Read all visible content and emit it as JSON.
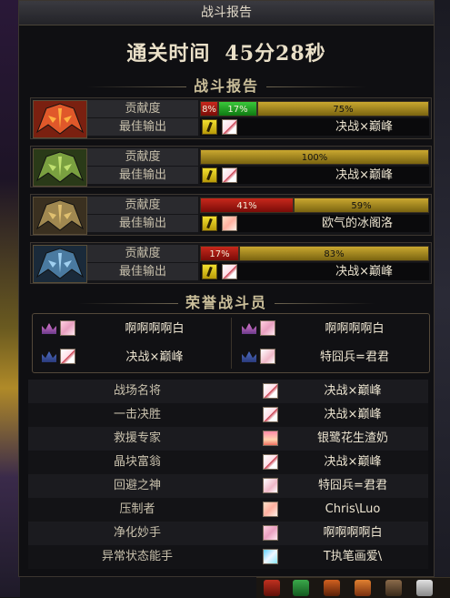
{
  "window": {
    "title": "战斗报告"
  },
  "clear_time": {
    "label": "通关时间",
    "value": "45分28秒"
  },
  "sections": {
    "battle_report": "战斗报告",
    "honor": "荣誉战斗员"
  },
  "teams": [
    {
      "contribution_label": "贡献度",
      "best_label": "最佳输出",
      "best_name": "决战×巅峰",
      "segments": [
        {
          "color": "red",
          "percent": 8,
          "text": "8%"
        },
        {
          "color": "green",
          "percent": 17,
          "text": "17%"
        },
        {
          "color": "gold",
          "percent": 75,
          "text": "75%"
        }
      ]
    },
    {
      "contribution_label": "贡献度",
      "best_label": "最佳输出",
      "best_name": "决战×巅峰",
      "segments": [
        {
          "color": "gold",
          "percent": 100,
          "text": "100%"
        }
      ]
    },
    {
      "contribution_label": "贡献度",
      "best_label": "最佳输出",
      "best_name": "欧气的冰阁洛",
      "segments": [
        {
          "color": "red",
          "percent": 41,
          "text": "41%"
        },
        {
          "color": "gold",
          "percent": 59,
          "text": "59%"
        }
      ]
    },
    {
      "contribution_label": "贡献度",
      "best_label": "最佳输出",
      "best_name": "决战×巅峰",
      "segments": [
        {
          "color": "red",
          "percent": 17,
          "text": "17%"
        },
        {
          "color": "gold",
          "percent": 83,
          "text": "83%"
        }
      ]
    }
  ],
  "honor_members": [
    {
      "name": "啊啊啊啊白"
    },
    {
      "name": "啊啊啊啊白"
    },
    {
      "name": "决战×巅峰"
    },
    {
      "name": "特囧兵=君君"
    }
  ],
  "awards": [
    {
      "title": "战场名将",
      "name": "决战×巅峰"
    },
    {
      "title": "一击决胜",
      "name": "决战×巅峰"
    },
    {
      "title": "救援专家",
      "name": "银鹭花生渣奶"
    },
    {
      "title": "晶块富翁",
      "name": "决战×巅峰"
    },
    {
      "title": "回避之神",
      "name": "特囧兵=君君"
    },
    {
      "title": "压制者",
      "name": "Chris\\Luo"
    },
    {
      "title": "净化妙手",
      "name": "啊啊啊啊白"
    },
    {
      "title": "异常状态能手",
      "name": "T执笔画爱\\"
    }
  ],
  "colors": {
    "red": "#c8281c",
    "green": "#3ac83a",
    "gold": "#caa830"
  }
}
